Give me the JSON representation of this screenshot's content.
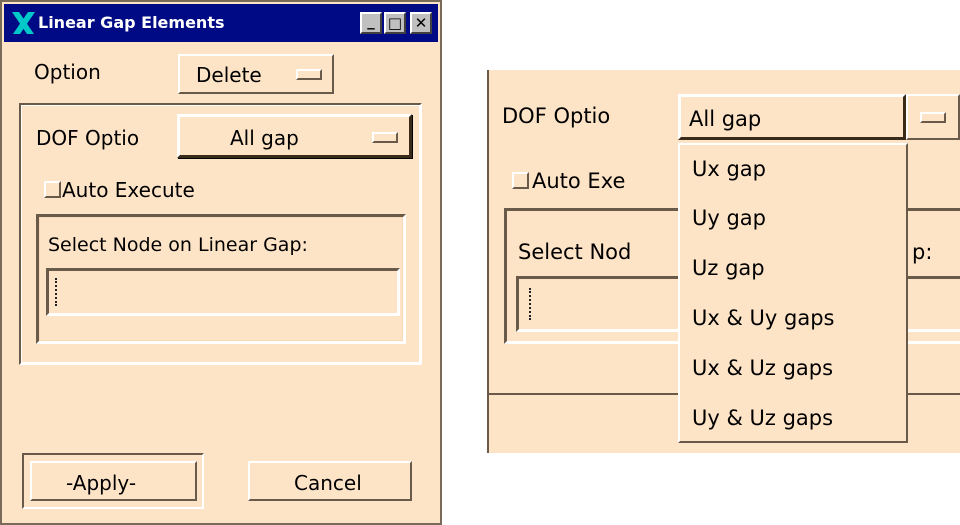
{
  "window": {
    "title": "Linear Gap Elements"
  },
  "titlebar_buttons": {
    "minimize": "_",
    "maximize": "□",
    "close": "✕"
  },
  "option": {
    "label": "Option",
    "value": "Delete"
  },
  "dof": {
    "label": "DOF Optio",
    "value": "All gap"
  },
  "auto_execute": {
    "label": "Auto Execute",
    "checked": false
  },
  "select": {
    "label": "Select Node on Linear Gap:",
    "value": ""
  },
  "buttons": {
    "apply": "-Apply-",
    "cancel": "Cancel"
  },
  "popup": {
    "dof_label": "DOF Optio",
    "selected": "All gap",
    "auto_execute_partial": "Auto Exe",
    "select_partial_left": "Select Nod",
    "select_partial_right": "p:",
    "options": [
      "Ux gap",
      "Uy gap",
      "Uz gap",
      "Ux & Uy gaps",
      "Ux & Uz gaps",
      "Uy & Uz gaps"
    ]
  }
}
